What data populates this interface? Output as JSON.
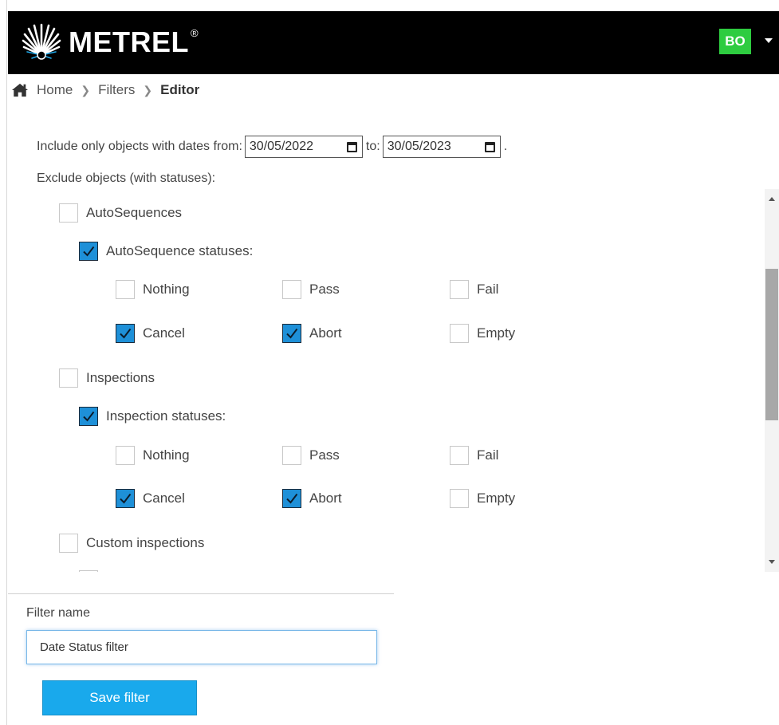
{
  "header": {
    "logo_text": "METREL",
    "logo_reg": "®",
    "user_initials": "BO",
    "colors": {
      "header_bg": "#000000",
      "avatar_bg": "#2ecc40",
      "accent": "#19a9ec"
    }
  },
  "breadcrumb": {
    "home": "Home",
    "filters": "Filters",
    "current": "Editor"
  },
  "date_filter": {
    "label_from": "Include only objects with dates from:",
    "from_value": "30/05/2022",
    "label_to": "to:",
    "to_value": "30/05/2023",
    "suffix": "."
  },
  "exclude": {
    "label": "Exclude objects (with statuses):",
    "groups": [
      {
        "label": "AutoSequences",
        "checked": false,
        "statuses_label": "AutoSequence statuses:",
        "statuses_checked": true,
        "statuses": [
          {
            "label": "Nothing",
            "checked": false
          },
          {
            "label": "Pass",
            "checked": false
          },
          {
            "label": "Fail",
            "checked": false
          },
          {
            "label": "Cancel",
            "checked": true
          },
          {
            "label": "Abort",
            "checked": true
          },
          {
            "label": "Empty",
            "checked": false
          }
        ]
      },
      {
        "label": "Inspections",
        "checked": false,
        "statuses_label": "Inspection statuses:",
        "statuses_checked": true,
        "statuses": [
          {
            "label": "Nothing",
            "checked": false
          },
          {
            "label": "Pass",
            "checked": false
          },
          {
            "label": "Fail",
            "checked": false
          },
          {
            "label": "Cancel",
            "checked": true
          },
          {
            "label": "Abort",
            "checked": true
          },
          {
            "label": "Empty",
            "checked": false
          }
        ]
      },
      {
        "label": "Custom inspections",
        "checked": false
      }
    ]
  },
  "filter_name": {
    "label": "Filter name",
    "value": "Date Status filter"
  },
  "save_button": "Save filter"
}
